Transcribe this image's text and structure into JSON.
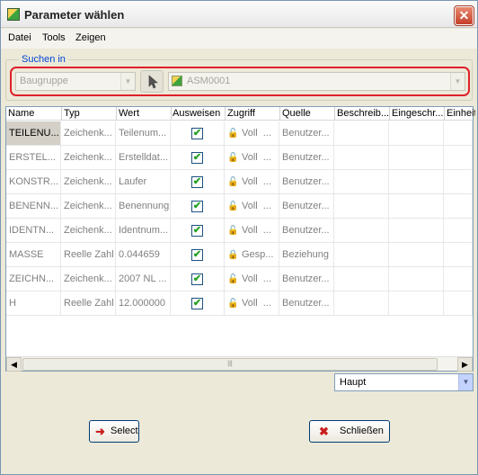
{
  "window": {
    "title": "Parameter wählen"
  },
  "menu": {
    "items": [
      "Datei",
      "Tools",
      "Zeigen"
    ]
  },
  "search": {
    "group_label": "Suchen in",
    "scope_value": "Baugruppe",
    "object_value": "ASM0001"
  },
  "table": {
    "columns": [
      "Name",
      "Typ",
      "Wert",
      "Ausweisen",
      "Zugriff",
      "Quelle",
      "Beschreib...",
      "Eingeschr...",
      "Einheit"
    ],
    "rows": [
      {
        "name": "TEILENU...",
        "typ": "Zeichenk...",
        "wert": "Teilenum...",
        "ausweisen": true,
        "zugriff": "Voll",
        "zugriff_suffix": "...",
        "quelle": "Benutzer...",
        "selected": true
      },
      {
        "name": "ERSTEL...",
        "typ": "Zeichenk...",
        "wert": "Erstelldat...",
        "ausweisen": true,
        "zugriff": "Voll",
        "zugriff_suffix": "...",
        "quelle": "Benutzer..."
      },
      {
        "name": "KONSTR...",
        "typ": "Zeichenk...",
        "wert": "Laufer",
        "ausweisen": true,
        "zugriff": "Voll",
        "zugriff_suffix": "...",
        "quelle": "Benutzer..."
      },
      {
        "name": "BENENN...",
        "typ": "Zeichenk...",
        "wert": "Benennung",
        "ausweisen": true,
        "zugriff": "Voll",
        "zugriff_suffix": "...",
        "quelle": "Benutzer..."
      },
      {
        "name": "IDENTN...",
        "typ": "Zeichenk...",
        "wert": "Identnum...",
        "ausweisen": true,
        "zugriff": "Voll",
        "zugriff_suffix": "...",
        "quelle": "Benutzer..."
      },
      {
        "name": "MASSE",
        "typ": "Reelle Zahl",
        "wert": "0.044659",
        "ausweisen": true,
        "zugriff": "Gesp...",
        "zugriff_suffix": "",
        "quelle": "Beziehung"
      },
      {
        "name": "ZEICHN...",
        "typ": "Zeichenk...",
        "wert": "2007 NL ...",
        "ausweisen": true,
        "zugriff": "Voll",
        "zugriff_suffix": "...",
        "quelle": "Benutzer..."
      },
      {
        "name": "H",
        "typ": "Reelle Zahl",
        "wert": "12.000000",
        "ausweisen": true,
        "zugriff": "Voll",
        "zugriff_suffix": "...",
        "quelle": "Benutzer..."
      }
    ]
  },
  "filter": {
    "value": "Haupt"
  },
  "buttons": {
    "select_label": "Select",
    "close_label": "Schließen"
  }
}
